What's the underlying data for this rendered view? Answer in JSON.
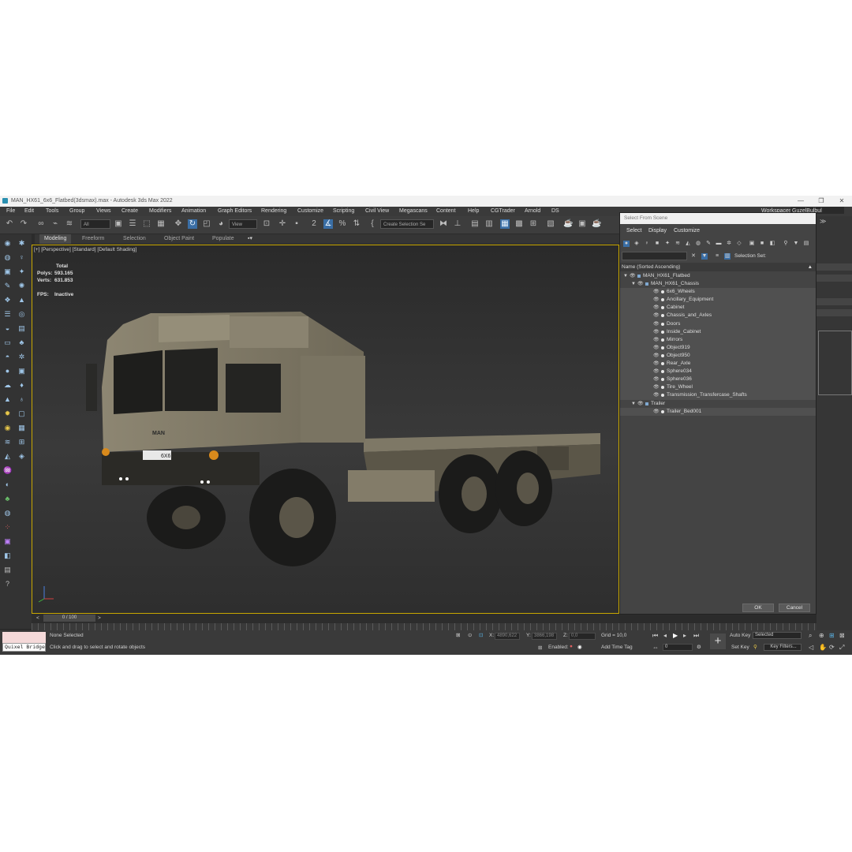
{
  "window": {
    "title": "MAN_HX61_6x6_Flatbed(3dsmax).max - Autodesk 3ds Max 2022",
    "minimize": "—",
    "maximize": "❐",
    "close": "✕"
  },
  "menu": [
    "File",
    "Edit",
    "Tools",
    "Group",
    "Views",
    "Create",
    "Modifiers",
    "Animation",
    "Graph Editors",
    "Rendering",
    "Customize",
    "Scripting",
    "Civil View",
    "Megascans",
    "Content",
    "Help",
    "CGTrader",
    "Arnold",
    "DS"
  ],
  "workspace": {
    "label": "Workspaces:",
    "value": "GuzelBulbul"
  },
  "toolbar": {
    "filter_dropdown": "All",
    "refcoord_dropdown": "View",
    "selection_set_dropdown": "Create Selection Se"
  },
  "ribbon": {
    "tabs": [
      "Modeling",
      "Freeform",
      "Selection",
      "Object Paint",
      "Populate"
    ],
    "active": "Modeling"
  },
  "viewport": {
    "label": "[+] [Perspective] [Standard] [Default Shading]",
    "stats_header": "Total",
    "polys_label": "Polys:",
    "polys_value": "593.165",
    "verts_label": "Verts:",
    "verts_value": "631.853",
    "fps_label": "FPS:",
    "fps_value": "Inactive",
    "plate_text": "6X6",
    "brand_text": "MAN"
  },
  "timeslider": {
    "value": "0 / 100",
    "prev": "<",
    "next": ">"
  },
  "status": {
    "quixel_label": "Quixel Bridge",
    "selection_text": "None Selected",
    "prompt_text": "Click and drag to select and rotate objects",
    "x_label": "X:",
    "x_value": "4890,622",
    "y_label": "Y:",
    "y_value": "3866,198",
    "z_label": "Z:",
    "z_value": "0,0",
    "grid": "Grid = 10,0",
    "enabled_label": "Enabled:",
    "add_time_tag": "Add Time Tag",
    "auto_key": "Auto Key",
    "set_key": "Set Key",
    "key_mode_dropdown": "Selected",
    "key_filters": "Key Filters...",
    "frame_value": "0"
  },
  "dialog": {
    "title": "Select From Scene",
    "menu": [
      "Select",
      "Display",
      "Customize"
    ],
    "selection_set_label": "Selection Set:",
    "column_header": "Name (Sorted Ascending)",
    "sort_arrow": "▲",
    "tree": [
      {
        "name": "MAN_HX61_Flatbed",
        "level": 0,
        "expanded": true
      },
      {
        "name": "MAN_HX61_Chassis",
        "level": 1,
        "expanded": true
      },
      {
        "name": "6x6_Wheels",
        "level": 2
      },
      {
        "name": "Ancillary_Equipment",
        "level": 2
      },
      {
        "name": "Cabinet",
        "level": 2
      },
      {
        "name": "Chassis_and_Axles",
        "level": 2
      },
      {
        "name": "Doors",
        "level": 2
      },
      {
        "name": "Inside_Cabinet",
        "level": 2
      },
      {
        "name": "Mirrors",
        "level": 2
      },
      {
        "name": "Object919",
        "level": 2
      },
      {
        "name": "Object950",
        "level": 2
      },
      {
        "name": "Rear_Axle",
        "level": 2
      },
      {
        "name": "Sphere034",
        "level": 2
      },
      {
        "name": "Sphere036",
        "level": 2
      },
      {
        "name": "Tire_Wheel",
        "level": 2
      },
      {
        "name": "Transmission_Transfercase_Shafts",
        "level": 2
      },
      {
        "name": "Trailer",
        "level": 1,
        "expanded": true
      },
      {
        "name": "Trailer_Bed001",
        "level": 2
      }
    ],
    "ok": "OK",
    "cancel": "Cancel"
  },
  "colors": {
    "accent": "#3a6ea5",
    "viewport_border": "#c9a800",
    "truck": "#8a8270"
  }
}
